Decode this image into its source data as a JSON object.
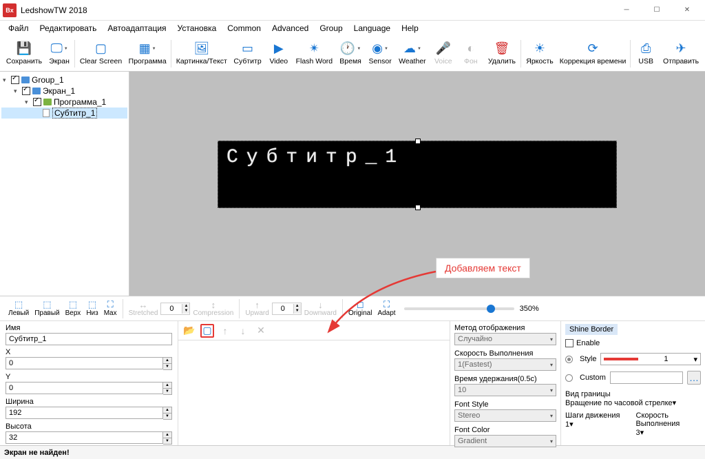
{
  "titlebar": {
    "app_name": "LedshowTW 2018",
    "icon_text": "Bx"
  },
  "menu": [
    "Файл",
    "Редактировать",
    "Автоадаптация",
    "Установка",
    "Common",
    "Advanced",
    "Group",
    "Language",
    "Help"
  ],
  "toolbar": [
    {
      "icon": "save",
      "label": "Сохранить"
    },
    {
      "icon": "screen",
      "label": "Экран",
      "dd": true
    },
    {
      "sep": true
    },
    {
      "icon": "clear",
      "label": "Clear Screen"
    },
    {
      "icon": "program",
      "label": "Программа",
      "dd": true
    },
    {
      "sep": true
    },
    {
      "icon": "image",
      "label": "Картинка/Текст"
    },
    {
      "icon": "subtitle",
      "label": "Субтитр"
    },
    {
      "icon": "video",
      "label": "Video"
    },
    {
      "icon": "flash",
      "label": "Flash Word"
    },
    {
      "icon": "time",
      "label": "Время",
      "dd": true
    },
    {
      "icon": "sensor",
      "label": "Sensor",
      "dd": true
    },
    {
      "icon": "weather",
      "label": "Weather",
      "dd": true
    },
    {
      "icon": "voice",
      "label": "Voice",
      "disabled": true
    },
    {
      "icon": "bg",
      "label": "Фон",
      "disabled": true
    },
    {
      "icon": "delete",
      "label": "Удалить"
    },
    {
      "sep": true
    },
    {
      "icon": "bright",
      "label": "Яркость"
    },
    {
      "icon": "timecorr",
      "label": "Коррекция времени"
    },
    {
      "sep": true
    },
    {
      "icon": "usb",
      "label": "USB"
    },
    {
      "icon": "send",
      "label": "Отправить"
    }
  ],
  "tree": {
    "group": "Group_1",
    "screen": "Экран_1",
    "program": "Программа_1",
    "subtitle": "Субтитр_1"
  },
  "preview_text": "Субтитр_1",
  "callout": "Добавляем текст",
  "align_bar": {
    "left": "Левый",
    "right": "Правый",
    "top": "Верх",
    "bottom": "Низ",
    "max": "Max",
    "stretched": "Stretched",
    "compression": "Compression",
    "upward": "Upward",
    "downward": "Downward",
    "original": "Original",
    "adapt": "Adapt",
    "zoom": "350%",
    "zero": "0"
  },
  "props": {
    "name_label": "Имя",
    "name_value": "Субтитр_1",
    "x_label": "X",
    "x_value": "0",
    "y_label": "Y",
    "y_value": "0",
    "w_label": "Ширина",
    "w_value": "192",
    "h_label": "Высота",
    "h_value": "32"
  },
  "mid_settings": {
    "method_label": "Метод отображения",
    "method_value": "Случайно",
    "speed_label": "Скорость Выполнения",
    "speed_value": "1(Fastest)",
    "hold_label": "Время удержания(0.5c)",
    "hold_value": "10",
    "fontstyle_label": "Font Style",
    "fontstyle_value": "Stereo",
    "fontcolor_label": "Font Color",
    "fontcolor_value": "Gradient"
  },
  "shine": {
    "tab": "Shine Border",
    "enable": "Enable",
    "style": "Style",
    "style_value": "1",
    "custom": "Custom",
    "border_kind": "Вид границы",
    "border_value": "Вращение по часовой стрелке",
    "steps": "Шаги движения",
    "steps_value": "1",
    "exec_speed": "Скорость Выполнения",
    "exec_speed_value": "3"
  },
  "status": "Экран не найден!"
}
